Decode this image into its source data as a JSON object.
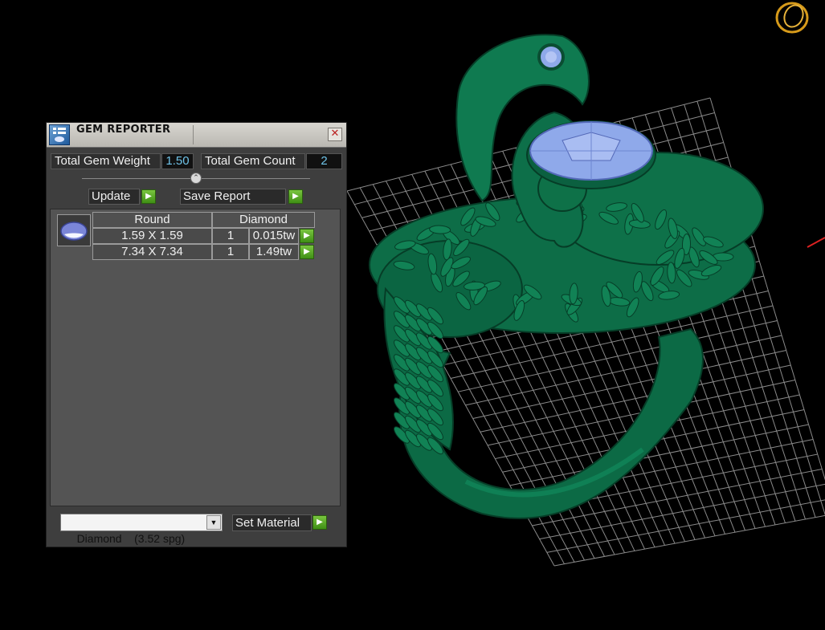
{
  "window": {
    "title": "GEM REPORTER",
    "close_glyph": "✕"
  },
  "stats": {
    "weight_label": "Total Gem Weight",
    "weight_value": "1.50",
    "count_label": "Total Gem Count",
    "count_value": "2"
  },
  "buttons": {
    "update_label": "Update",
    "save_label": "Save Report",
    "set_material_label": "Set Material"
  },
  "gem_table": {
    "headers": [
      "Round",
      "Diamond"
    ],
    "rows": [
      {
        "size": "1.59 X 1.59",
        "qty": "1",
        "weight": "0.015tw"
      },
      {
        "size": "7.34 X 7.34",
        "qty": "1",
        "weight": "1.49tw"
      }
    ]
  },
  "material": {
    "selected": "Diamond    (3.52 spg)"
  },
  "viewport": {
    "model_color": "#0c6a45",
    "gem_color": "#8fa9ea",
    "grid_color": "#b8b8b8",
    "icons": [
      "ring-logo-icon",
      "arrow-icon",
      "gem-icon",
      "close-icon"
    ]
  }
}
